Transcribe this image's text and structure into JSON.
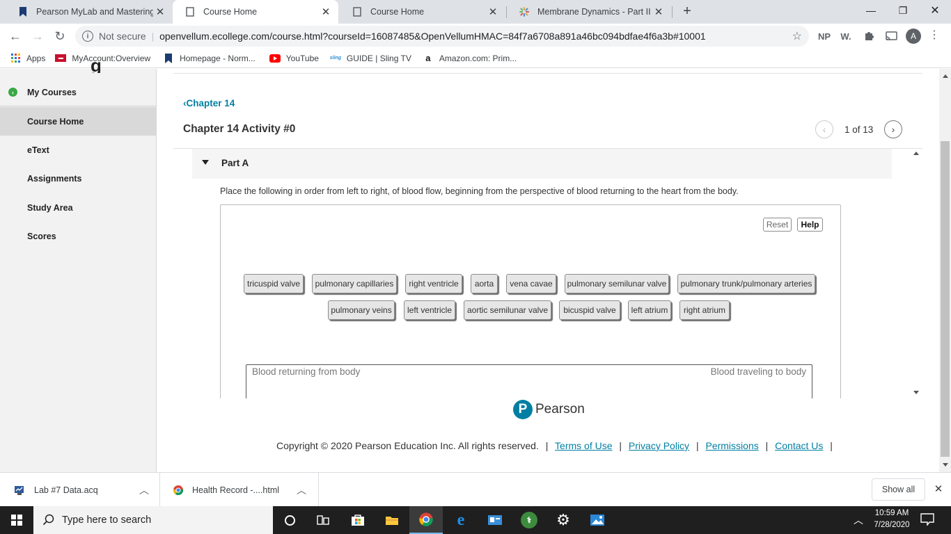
{
  "browser": {
    "tabs": [
      {
        "title": "Pearson MyLab and Mastering - S",
        "active": false
      },
      {
        "title": "Course Home",
        "active": true
      },
      {
        "title": "Course Home",
        "active": false
      },
      {
        "title": "Membrane Dynamics - Part II - M",
        "active": false
      }
    ],
    "new_tab": "+",
    "window": {
      "minimize": "—",
      "restore": "❐",
      "close": "✕"
    },
    "nav": {
      "back": "←",
      "forward": "→",
      "reload": "↻"
    },
    "security": "Not secure",
    "url": "openvellum.ecollege.com/course.html?courseId=16087485&OpenVellumHMAC=84f7a6708a891a46bc094bdfae4f6a3b#10001",
    "extensions": [
      "NP",
      "W.",
      "puzzle-icon",
      "cast-icon"
    ],
    "profile_initial": "A",
    "bookmarks": [
      {
        "label": "Apps"
      },
      {
        "label": "MyAccount:Overview"
      },
      {
        "label": "Homepage - Norm..."
      },
      {
        "label": "YouTube"
      },
      {
        "label": "GUIDE | Sling TV"
      },
      {
        "label": "Amazon.com: Prim..."
      }
    ]
  },
  "sidebar": {
    "items": [
      {
        "label": "My Courses"
      },
      {
        "label": "Course Home"
      },
      {
        "label": "eText"
      },
      {
        "label": "Assignments"
      },
      {
        "label": "Study Area"
      },
      {
        "label": "Scores"
      }
    ]
  },
  "main": {
    "breadcrumb": "Chapter 14",
    "title": "Chapter 14 Activity #0",
    "pagination": "1 of 13",
    "part_label": "Part A",
    "instruction": "Place the following in order from left to right, of blood flow, beginning from the perspective of blood returning to the heart from the body.",
    "reset_label": "Reset",
    "help_label": "Help",
    "chips_row1": [
      "tricuspid valve",
      "pulmonary capillaries",
      "right ventricle",
      "aorta",
      "vena cavae",
      "pulmonary semilunar valve",
      "pulmonary trunk/pulmonary arteries"
    ],
    "chips_row2": [
      "pulmonary veins",
      "left ventricle",
      "aortic semilunar valve",
      "bicuspid valve",
      "left atrium",
      "right atrium"
    ],
    "drop_left_label": "Blood returning from body",
    "drop_right_label": "Blood traveling to body"
  },
  "footer": {
    "brand": "Pearson",
    "copyright": "Copyright © 2020 Pearson Education Inc. All rights reserved.",
    "links": [
      "Terms of Use",
      "Privacy Policy",
      "Permissions",
      "Contact Us"
    ]
  },
  "downloads": {
    "items": [
      {
        "name": "Lab #7 Data.acq"
      },
      {
        "name": "Health Record -....html"
      }
    ],
    "show_all": "Show all"
  },
  "taskbar": {
    "search_placeholder": "Type here to search",
    "time": "10:59 AM",
    "date": "7/28/2020"
  }
}
